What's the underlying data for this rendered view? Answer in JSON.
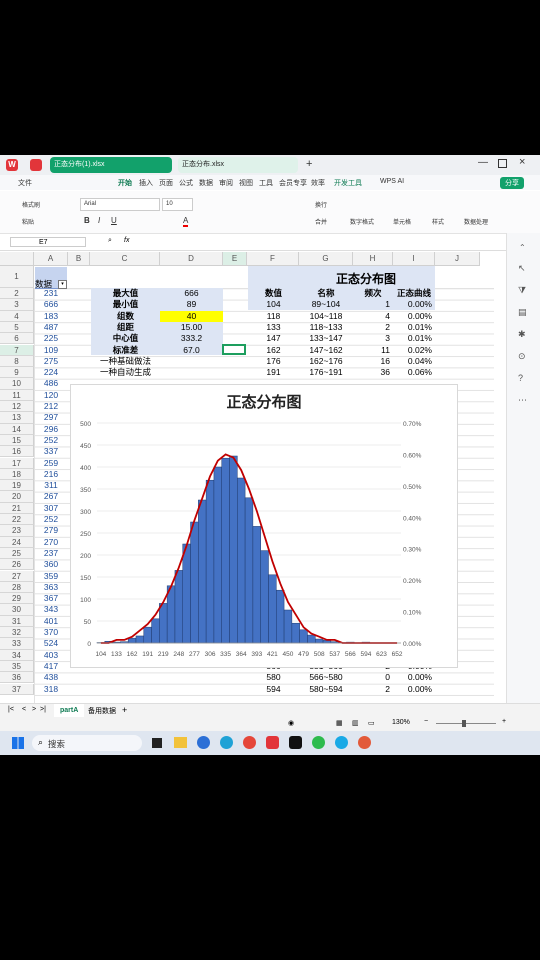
{
  "app": {
    "tabs": [
      {
        "label": "正态分布(1).xlsx"
      },
      {
        "label": "正态分布.xlsx"
      }
    ],
    "menu": [
      "文件",
      "开始",
      "插入",
      "页面",
      "公式",
      "数据",
      "审阅",
      "视图",
      "工具",
      "会员专享",
      "效率",
      "开发工具",
      "WPS AI"
    ],
    "share_label": "分享",
    "ribbon": {
      "format_painter": "格式刷",
      "paste": "粘贴",
      "font": "Arial",
      "font_size": "10",
      "wrap": "换行",
      "merge": "合并",
      "number_format": "数字格式",
      "cell": "单元格",
      "style": "样式",
      "data_process": "数据处理"
    },
    "name_box": "E7",
    "fx": "fx"
  },
  "columns": [
    "A",
    "B",
    "C",
    "D",
    "E",
    "F",
    "G",
    "H",
    "I",
    "J"
  ],
  "rows": [
    "1",
    "2",
    "3",
    "4",
    "5",
    "6",
    "7",
    "8",
    "9",
    "10",
    "11",
    "12",
    "13",
    "14",
    "15",
    "16",
    "17",
    "18",
    "19",
    "20",
    "21",
    "22",
    "23",
    "24",
    "25",
    "26",
    "27",
    "28",
    "29",
    "30",
    "31",
    "32",
    "33",
    "34",
    "35",
    "36",
    "37"
  ],
  "col_a": {
    "header": "数据",
    "values": [
      "231",
      "666",
      "183",
      "487",
      "225",
      "109",
      "275",
      "224",
      "486",
      "120",
      "212",
      "297",
      "296",
      "252",
      "337",
      "259",
      "216",
      "311",
      "267",
      "307",
      "252",
      "279",
      "270",
      "237",
      "360",
      "359",
      "363",
      "367",
      "343",
      "401",
      "370",
      "524",
      "403",
      "417",
      "438",
      "318"
    ]
  },
  "stats": {
    "labels": [
      "最大值",
      "最小值",
      "组数",
      "组距",
      "中心值",
      "标准差"
    ],
    "values": [
      "666",
      "89",
      "40",
      "15.00",
      "333.2",
      "67.0"
    ],
    "method1": "一种基础做法",
    "method2": "一种自动生成"
  },
  "table": {
    "title": "正态分布图",
    "headers": [
      "数值",
      "名称",
      "频次",
      "正态曲线"
    ],
    "top_rows": [
      [
        "104",
        "89~104",
        "1",
        "0.00%"
      ],
      [
        "118",
        "104~118",
        "4",
        "0.00%"
      ],
      [
        "133",
        "118~133",
        "2",
        "0.01%"
      ],
      [
        "147",
        "133~147",
        "3",
        "0.01%"
      ],
      [
        "162",
        "147~162",
        "11",
        "0.02%"
      ],
      [
        "176",
        "162~176",
        "16",
        "0.04%"
      ],
      [
        "191",
        "176~191",
        "36",
        "0.06%"
      ]
    ],
    "bottom_rows": [
      [
        "566",
        "551~566",
        "2",
        "0.00%"
      ],
      [
        "580",
        "566~580",
        "0",
        "0.00%"
      ],
      [
        "594",
        "580~594",
        "2",
        "0.00%"
      ]
    ]
  },
  "sheets": [
    "partA",
    "备用数据"
  ],
  "status": {
    "zoom": "130%"
  },
  "taskbar": {
    "search": "搜索"
  },
  "colors": {
    "bar": "#4472c4",
    "curve": "#c00000",
    "highlight": "#ffff00",
    "header_fill": "#dde5f4"
  },
  "chart_data": {
    "type": "bar",
    "title": "正态分布图",
    "categories": [
      "104",
      "118",
      "133",
      "147",
      "162",
      "176",
      "191",
      "205",
      "219",
      "234",
      "248",
      "263",
      "277",
      "292",
      "306",
      "321",
      "335",
      "350",
      "364",
      "378",
      "393",
      "407",
      "421",
      "436",
      "450",
      "465",
      "479",
      "494",
      "508",
      "523",
      "537",
      "551",
      "566",
      "580",
      "594",
      "609",
      "623",
      "637",
      "652"
    ],
    "x_tick_labels": [
      "104",
      "133",
      "162",
      "191",
      "219",
      "248",
      "277",
      "306",
      "335",
      "364",
      "393",
      "421",
      "450",
      "479",
      "508",
      "537",
      "566",
      "594",
      "623",
      "652"
    ],
    "series": [
      {
        "type": "bar",
        "values": [
          1,
          4,
          2,
          3,
          11,
          16,
          36,
          55,
          90,
          130,
          165,
          225,
          275,
          325,
          370,
          400,
          420,
          425,
          375,
          330,
          265,
          210,
          155,
          120,
          75,
          45,
          30,
          18,
          9,
          6,
          3,
          1,
          2,
          0,
          2,
          0,
          0,
          0,
          0
        ]
      },
      {
        "type": "line",
        "values": [
          0.0,
          0.0,
          0.01,
          0.01,
          0.02,
          0.04,
          0.06,
          0.09,
          0.13,
          0.18,
          0.24,
          0.31,
          0.39,
          0.46,
          0.53,
          0.58,
          0.6,
          0.59,
          0.55,
          0.49,
          0.42,
          0.34,
          0.26,
          0.19,
          0.13,
          0.09,
          0.05,
          0.03,
          0.02,
          0.01,
          0.01,
          0.0,
          0.0,
          0.0,
          0.0,
          0.0,
          0.0,
          0.0,
          0.0
        ]
      }
    ],
    "y_left": {
      "ticks": [
        "0",
        "50",
        "100",
        "150",
        "200",
        "250",
        "300",
        "350",
        "400",
        "450",
        "500"
      ],
      "ylim": [
        0,
        500
      ]
    },
    "y_right": {
      "ticks": [
        "0.00%",
        "0.10%",
        "0.20%",
        "0.30%",
        "0.40%",
        "0.50%",
        "0.60%",
        "0.70%"
      ],
      "ylim": [
        0,
        0.7
      ]
    }
  }
}
